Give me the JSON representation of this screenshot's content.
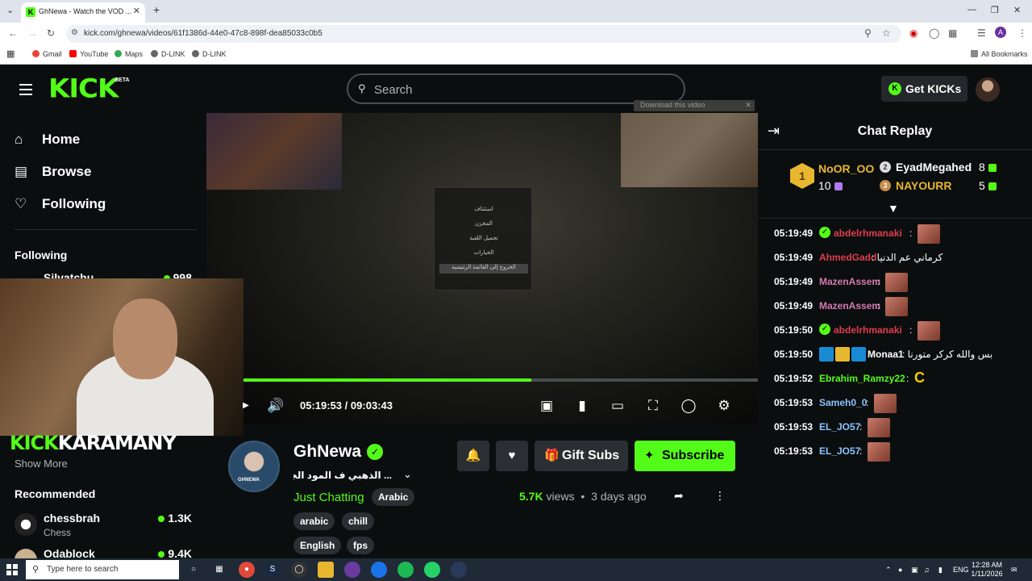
{
  "browser": {
    "tab_title": "GhNewa - Watch the VOD ...",
    "url": "kick.com/ghnewa/videos/61f1386d-44e0-47c8-898f-dea85033c0b5",
    "bookmarks": [
      "Gmail",
      "YouTube",
      "Maps",
      "D-LINK",
      "D-LINK"
    ],
    "all_bookmarks": "All Bookmarks",
    "profile_initial": "A"
  },
  "header": {
    "logo": "KICK",
    "beta": "BETA",
    "search_placeholder": "Search",
    "get_kicks": "Get KICKs"
  },
  "sidebar": {
    "nav": [
      {
        "label": "Home",
        "icon": "home-icon"
      },
      {
        "label": "Browse",
        "icon": "browse-icon"
      },
      {
        "label": "Following",
        "icon": "heart-icon"
      }
    ],
    "following_heading": "Following",
    "following_partial": {
      "name": "Silvatchu",
      "viewers": "998"
    },
    "show_more": "Show More",
    "recommended_heading": "Recommended",
    "recommended": [
      {
        "name": "chessbrah",
        "category": "Chess",
        "viewers": "1.3K"
      },
      {
        "name": "Odablock",
        "category": "",
        "viewers": "9.4K"
      }
    ]
  },
  "video": {
    "download_bar": "Download this video",
    "overlay_brand_left": "KICK",
    "overlay_brand_right": "KARAMANY",
    "ingame_menu": [
      "استئناف",
      "المخزن",
      "تحميل اللعبة",
      "الخيارات",
      "الخروج إلى القائمة الرئيسية"
    ],
    "progress": 0.56
  },
  "player": {
    "current_time": "05:19:53",
    "separator": "/",
    "duration": "09:03:43"
  },
  "channel": {
    "name": "GhNewa",
    "avatar_label": "GHNEWA",
    "title": "... الذهبي ف المود الجديد",
    "category": "Just Chatting",
    "language_tag": "Arabic",
    "tags": [
      "arabic",
      "chill",
      "English",
      "fps"
    ],
    "gift_subs": "Gift Subs",
    "subscribe": "Subscribe",
    "views": "5.7K",
    "views_label": "views",
    "dot": "•",
    "posted": "3 days ago"
  },
  "chat": {
    "title": "Chat Replay",
    "leaderboard": [
      {
        "rank": "1",
        "name": "NoOR_OO",
        "count": "10"
      },
      {
        "rank": "2",
        "name": "EyadMegahed",
        "count": "8"
      },
      {
        "rank": "3",
        "name": "NAYOURR",
        "count": "5"
      }
    ],
    "messages": [
      {
        "time": "05:19:49",
        "user": "abdelrhmanaki",
        "text": ":",
        "color": "#e03c4e",
        "emote": true,
        "badge": "verified"
      },
      {
        "time": "05:19:49",
        "user": "AhmedGadd",
        "text": ": كرماني عم الدنيا",
        "color": "#e03c4e",
        "emote": false,
        "badge": ""
      },
      {
        "time": "05:19:49",
        "user": "MazenAssem",
        "text": ":",
        "color": "#d47ab0",
        "emote": true,
        "badge": ""
      },
      {
        "time": "05:19:49",
        "user": "MazenAssem",
        "text": ":",
        "color": "#d47ab0",
        "emote": true,
        "badge": ""
      },
      {
        "time": "05:19:50",
        "user": "abdelrhmanaki",
        "text": ":",
        "color": "#e03c4e",
        "emote": true,
        "badge": "verified"
      },
      {
        "time": "05:19:50",
        "user": "Monaa1",
        "text": ": بس والله كركر متورنا",
        "color": "#ffffff",
        "emote": false,
        "badge": "multi"
      },
      {
        "time": "05:19:52",
        "user": "Ebrahim_Ramzy22",
        "text": ":",
        "color": "#53fc18",
        "emote": false,
        "badge": "",
        "glyph": "C"
      },
      {
        "time": "05:19:53",
        "user": "Sameh0_0",
        "text": ":",
        "color": "#8ac4ff",
        "emote": true,
        "badge": ""
      },
      {
        "time": "05:19:53",
        "user": "EL_JO57",
        "text": ":",
        "color": "#8ac4ff",
        "emote": true,
        "badge": ""
      },
      {
        "time": "05:19:53",
        "user": "EL_JO57",
        "text": ":",
        "color": "#8ac4ff",
        "emote": true,
        "badge": ""
      }
    ]
  },
  "taskbar": {
    "search_placeholder": "Type here to search",
    "lang": "ENG",
    "time": "12:28 AM",
    "date": "1/11/2026"
  },
  "colors": {
    "accent": "#53fc18",
    "bg": "#0b0e0f",
    "panel": "#2b2f33"
  }
}
